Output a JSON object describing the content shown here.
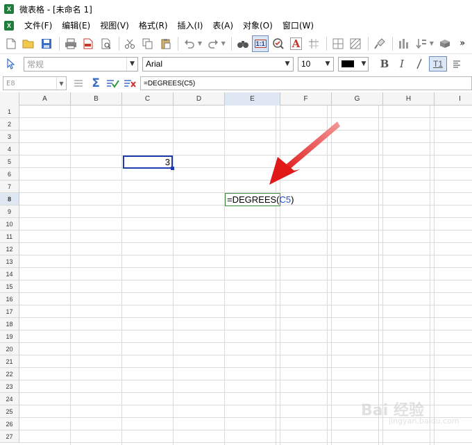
{
  "window": {
    "title": "微表格 - [未命名 1]",
    "app_icon": "X"
  },
  "menubar": {
    "items": [
      "文件(F)",
      "编辑(E)",
      "视图(V)",
      "格式(R)",
      "插入(I)",
      "表(A)",
      "对象(O)",
      "窗口(W)"
    ]
  },
  "toolbar": {
    "icons": [
      "new-doc-icon",
      "open-folder-icon",
      "save-icon",
      "print-icon",
      "export-pdf-icon",
      "print-preview-icon",
      "cut-icon",
      "copy-icon",
      "paste-icon",
      "undo-icon",
      "redo-icon",
      "find-icon",
      "zoom-actual-icon",
      "spellcheck-icon",
      "text-color-icon",
      "freeze-icon",
      "borders-icon",
      "pattern-icon",
      "format-painter-icon",
      "chart-icon",
      "sort-icon",
      "plugin-icon"
    ],
    "zoom_label": "1:1",
    "text_label": "A",
    "more": "»"
  },
  "format_bar": {
    "style_value": "常规",
    "font_value": "Arial",
    "size_value": "10",
    "bold": "B",
    "italic": "I",
    "align_label": "T1",
    "text_color": "#000000"
  },
  "formula_bar": {
    "name_box": "E8",
    "content": "=DEGREES(C5)"
  },
  "columns": [
    "A",
    "B",
    "C",
    "D",
    "E",
    "F",
    "G",
    "H",
    "I"
  ],
  "active_column": "E",
  "rows": [
    "1",
    "2",
    "3",
    "4",
    "5",
    "6",
    "7",
    "8",
    "9",
    "10",
    "11",
    "12",
    "13",
    "14",
    "15",
    "16",
    "17",
    "18",
    "19",
    "20",
    "21",
    "22",
    "23",
    "24",
    "25",
    "26",
    "27"
  ],
  "active_row": "8",
  "cells": {
    "C5": "3",
    "E8_prefix": "=DEGREES(",
    "E8_ref": "C5",
    "E8_suffix": ")"
  },
  "watermark": {
    "text": "Bai 经验",
    "sub": "jingyan.baidu.com"
  },
  "colors": {
    "selection": "#1f3bb0",
    "edit_border": "#3c8c3c",
    "annotation_arrow": "#e02020"
  }
}
